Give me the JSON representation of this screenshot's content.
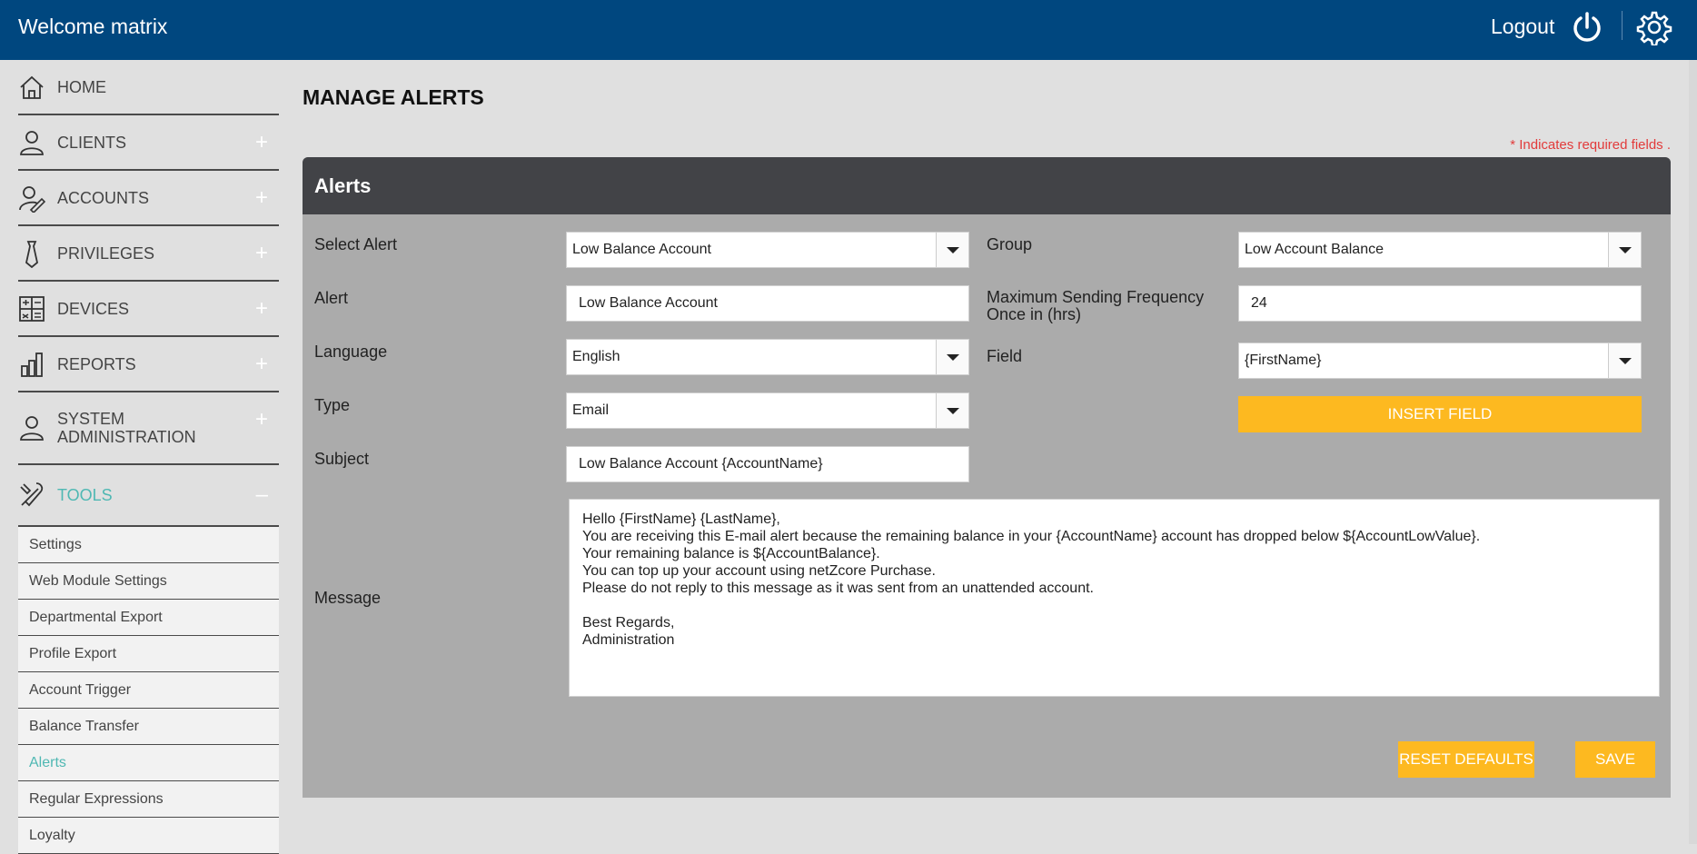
{
  "topbar": {
    "welcome": "Welcome matrix",
    "logout": "Logout",
    "bg_color": "#00477f"
  },
  "sidebar": {
    "items": [
      {
        "label": "HOME",
        "icon": "home-icon",
        "expand": ""
      },
      {
        "label": "CLIENTS",
        "icon": "user-icon",
        "expand": "+"
      },
      {
        "label": "ACCOUNTS",
        "icon": "account-edit-icon",
        "expand": "+"
      },
      {
        "label": "PRIVILEGES",
        "icon": "tie-icon",
        "expand": "+"
      },
      {
        "label": "DEVICES",
        "icon": "calculator-icon",
        "expand": "+"
      },
      {
        "label": "REPORTS",
        "icon": "bar-chart-icon",
        "expand": "+"
      },
      {
        "label": "SYSTEM ADMINISTRATION",
        "icon": "admin-user-icon",
        "expand": "+"
      },
      {
        "label": "TOOLS",
        "icon": "tools-icon",
        "expand": "–"
      }
    ],
    "tools_sub": [
      "Settings",
      "Web Module Settings",
      "Departmental Export",
      "Profile Export",
      "Account Trigger",
      "Balance Transfer",
      "Alerts",
      "Regular Expressions",
      "Loyalty"
    ],
    "active_color": "#4fb8b3"
  },
  "main": {
    "title": "MANAGE ALERTS",
    "required_note": "* Indicates required fields .",
    "panel_title": "Alerts",
    "form": {
      "select_alert_label": "Select Alert",
      "select_alert_value": "Low Balance Account",
      "alert_label": "Alert",
      "alert_value": "Low Balance Account",
      "language_label": "Language",
      "language_value": "English",
      "type_label": "Type",
      "type_value": "Email",
      "subject_label": "Subject",
      "subject_value": "Low Balance Account {AccountName}",
      "group_label": "Group",
      "group_value": "Low Account Balance",
      "freq_label_1": "Maximum Sending Frequency",
      "freq_label_2": "Once in (hrs)",
      "freq_value": "24",
      "field_label": "Field",
      "field_value": "{FirstName}",
      "insert_field": "INSERT FIELD",
      "message_label": "Message",
      "message_lines": [
        "Hello {FirstName} {LastName},",
        "You are receiving this E-mail alert because the remaining balance in your {AccountName} account has dropped below ${AccountLowValue}.",
        "Your remaining balance is ${AccountBalance}.",
        "You can top up your account using netZcore Purchase.",
        "Please do not reply to this message as it was sent from an unattended account.",
        "",
        "Best Regards,",
        "Administration"
      ],
      "reset_defaults": "RESET DEFAULTS",
      "save": "SAVE"
    },
    "button_color": "#fdb920"
  }
}
